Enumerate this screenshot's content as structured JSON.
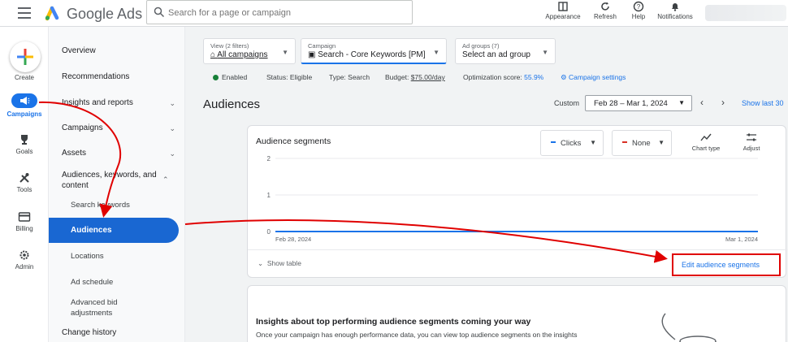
{
  "app": {
    "brand": "Google Ads"
  },
  "search": {
    "placeholder": "Search for a page or campaign"
  },
  "top_actions": [
    {
      "label": "Appearance",
      "icon": "appearance-icon"
    },
    {
      "label": "Refresh",
      "icon": "refresh-icon"
    },
    {
      "label": "Help",
      "icon": "help-icon"
    },
    {
      "label": "Notifications",
      "icon": "bell-icon"
    }
  ],
  "rail": {
    "create": "Create",
    "items": [
      {
        "label": "Campaigns",
        "icon": "megaphone-icon",
        "active": true
      },
      {
        "label": "Goals",
        "icon": "trophy-icon"
      },
      {
        "label": "Tools",
        "icon": "tools-icon"
      },
      {
        "label": "Billing",
        "icon": "card-icon"
      },
      {
        "label": "Admin",
        "icon": "gear-icon"
      }
    ]
  },
  "nav": {
    "items": [
      {
        "label": "Overview"
      },
      {
        "label": "Recommendations"
      },
      {
        "label": "Insights and reports",
        "chevron": "⌄"
      },
      {
        "label": "Campaigns",
        "chevron": "⌄"
      },
      {
        "label": "Assets",
        "chevron": "⌄"
      },
      {
        "label": "Audiences, keywords, and content",
        "chevron": "⌃"
      }
    ],
    "sub_items": [
      "Search keywords",
      "Audiences",
      "Locations",
      "Ad schedule",
      "Advanced bid adjustments"
    ],
    "footer_item": "Change history"
  },
  "pickers": {
    "view": {
      "small": "View (2 filters)",
      "value": "All campaigns"
    },
    "campaign": {
      "small": "Campaign",
      "value": "Search - Core Keywords [PM]"
    },
    "adgroup": {
      "small": "Ad groups (7)",
      "value": "Select an ad group"
    }
  },
  "status": {
    "enabled": "Enabled",
    "status": "Status: Eligible",
    "type": "Type: Search",
    "budget_label": "Budget:",
    "budget_value": "$75.00/day",
    "opt_label": "Optimization score:",
    "opt_value": "55.9%",
    "settings": "Campaign settings"
  },
  "page": {
    "title": "Audiences"
  },
  "date": {
    "custom": "Custom",
    "range": "Feb 28 – Mar 1, 2024",
    "show_last": "Show last 30"
  },
  "segments_card": {
    "title": "Audience segments",
    "metric1": "Clicks",
    "metric2": "None",
    "chart_type": "Chart type",
    "adjust": "Adjust",
    "show_table": "Show table",
    "edit_link": "Edit audience segments"
  },
  "chart_data": {
    "type": "line",
    "x": [
      "Feb 28, 2024",
      "Mar 1, 2024"
    ],
    "series": [
      {
        "values": [
          0,
          0
        ]
      }
    ],
    "ylim": [
      0,
      2
    ],
    "yticks": [
      "2",
      "1",
      "0"
    ],
    "xlabel": "",
    "ylabel": "",
    "grid": true
  },
  "insights_card": {
    "title": "Insights about top performing audience segments coming your way",
    "body": "Once your campaign has enough performance data, you can view top audience segments on the insights"
  },
  "colors": {
    "accent": "#1a73e8",
    "annotation": "#e00000",
    "clicks": "#1a73e8",
    "none": "#d93025"
  }
}
